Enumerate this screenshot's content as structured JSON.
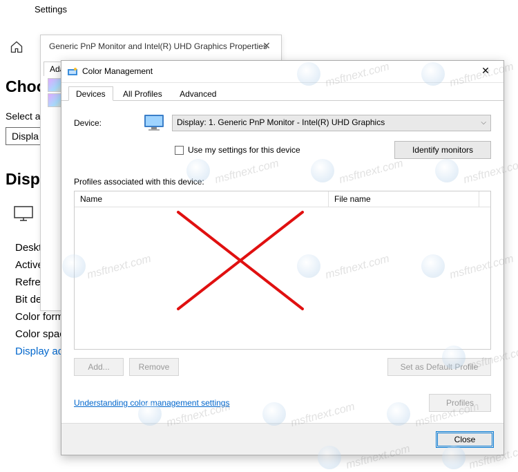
{
  "settings": {
    "header": "Settings",
    "choose_heading": "Choo",
    "select_label": "Select a",
    "display_stub": "Displa",
    "display_heading": "Displa",
    "left_list": {
      "desktop": "Deskt",
      "active": "Active",
      "refresh": "Refres",
      "bitdepth": "Bit de",
      "colorformat": "Color format",
      "colorspace": "Color space",
      "displayadapter": "Display adap"
    }
  },
  "props_dialog": {
    "title": "Generic PnP Monitor and Intel(R) UHD Graphics Properties",
    "tab": "Adapt"
  },
  "cm": {
    "title": "Color Management",
    "tabs": {
      "devices": "Devices",
      "all_profiles": "All Profiles",
      "advanced": "Advanced"
    },
    "device_label": "Device:",
    "device_value": "Display: 1. Generic PnP Monitor - Intel(R) UHD Graphics",
    "use_settings": "Use my settings for this device",
    "identify": "Identify monitors",
    "profiles_label": "Profiles associated with this device:",
    "columns": {
      "name": "Name",
      "file": "File name"
    },
    "buttons": {
      "add": "Add...",
      "remove": "Remove",
      "set_default": "Set as Default Profile",
      "profiles": "Profiles"
    },
    "link": "Understanding color management settings",
    "close": "Close"
  },
  "watermark": "msftnext.com"
}
